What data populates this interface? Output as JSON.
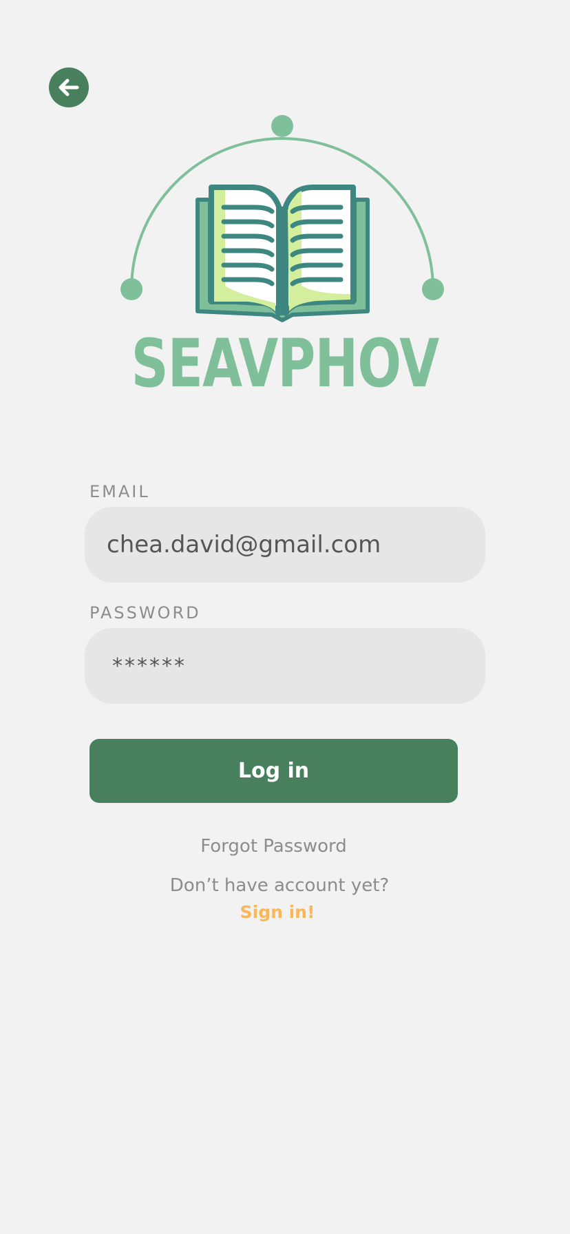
{
  "header": {
    "back_icon": "arrow-left-icon"
  },
  "logo": {
    "icon": "open-book-icon",
    "brand_name": "SEAVPHOV"
  },
  "form": {
    "email": {
      "label": "EMAIL",
      "value": "chea.david@gmail.com"
    },
    "password": {
      "label": "PASSWORD",
      "value": "******"
    },
    "login_label": "Log in"
  },
  "links": {
    "forgot_password": "Forgot Password",
    "no_account": "Don’t have account yet?",
    "sign_in": "Sign in!"
  },
  "colors": {
    "background": "#f2f2f2",
    "primary_green": "#48805e",
    "light_green": "#7fbf99",
    "teal": "#3e8781",
    "accent_orange": "#f8b759",
    "input_background": "#e6e6e6"
  }
}
